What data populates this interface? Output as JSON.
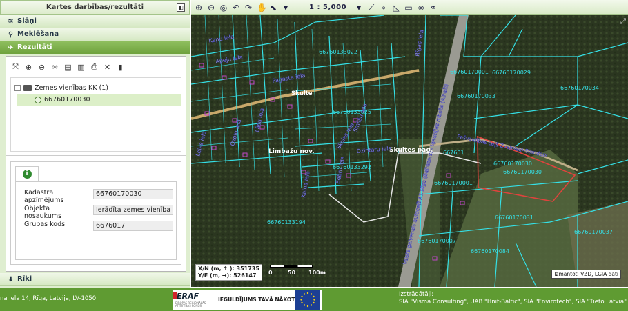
{
  "panel": {
    "title": "Kartes darbības/rezultāti",
    "collapse_glyph": "◧",
    "sections": {
      "layers": "Slāņi",
      "search": "Meklēšana",
      "results": "Rezultāti",
      "tools": "Rīki"
    }
  },
  "results": {
    "tree": {
      "group_label": "Zemes vienības KK (1)",
      "expand_glyph": "−",
      "item_label": "66760170030"
    },
    "fields": [
      {
        "label": "Kadastra apzīmējums",
        "value": "66760170030"
      },
      {
        "label": "Objekta nosaukums",
        "value": "Ierādīta zemes vienība"
      },
      {
        "label": "Grupas kods",
        "value": "6676017"
      }
    ],
    "info_glyph": "i"
  },
  "toolbar": {
    "scale": "1 : 5,000"
  },
  "map": {
    "coords": {
      "xn": "X/N (m, ↑ ): 351735",
      "ye": "Y/E (m, →): 526147"
    },
    "scalebar": {
      "l0": "0",
      "l1": "50",
      "l2": "100m"
    },
    "credit": "Izmantoti VZD, LGIA dati",
    "labels": {
      "l1": "66760133022",
      "l2": "66760133025",
      "l3": "66760170029",
      "l4": "66760170033",
      "l5": "66760170034",
      "l6": "66760133292",
      "l7": "66760170030",
      "l8": "66760170030",
      "l9": "66760170001",
      "l10": "66760170031",
      "l11": "66760133194",
      "l12": "66760170007",
      "l13": "66760170084",
      "l14": "66760170037",
      "l15": "667601",
      "l16": "66760170001",
      "t_limbazu": "Limbažu nov.",
      "t_skultes": "Skultes pag.",
      "t_skulte": "Skulte",
      "s_pagasta": "Pagasta iela",
      "s_rigas": "Rīgas iela",
      "s_apeju": "Apeju iela",
      "s_kapu": "Kapu iela",
      "s_lejas": "Lejas iela",
      "s_ozolu": "Ozolu iela",
      "s_lasu": "Lāsu iela",
      "s_kalna": "Kalna iela",
      "s_bebru": "Bebru iela",
      "s_skolas": "Skolas iela",
      "s_smilsu": "Smilšu iela",
      "s_dzintaru": "Dzintaru iela",
      "s_pasvaldibas": "Pašvaldības ceļš Zvejnieki-Stenders",
      "s_highway": "Valsts galvenais autoceļš A1 Rīga (Baltezers) - Igaunijas robeža (Ainaži)"
    }
  },
  "footer": {
    "address": "na iela 14, Rīga, Latvija, LV-1050.",
    "eraf": "ERAF",
    "eraf_sub": "EIROPAS REĢIONĀLĀS ATTĪSTĪBAS FONDS",
    "slogan": "IEGULDĪJUMS TAVĀ NĀKOTNĒ!",
    "developer_label": "Izstrādātāji:",
    "developers": "SIA \"Visma Consulting\", UAB \"Hnit-Baltic\", SIA \"Envirotech\", SIA \"Tieto Latvia\""
  },
  "colors": {
    "panel_bg": "#dfeed0",
    "accent_green": "#6ea23d",
    "footer_green": "#5f9b32",
    "parcel_line": "#35e0e6",
    "selected_parcel": "#e0433d",
    "building": "#c046c8"
  }
}
